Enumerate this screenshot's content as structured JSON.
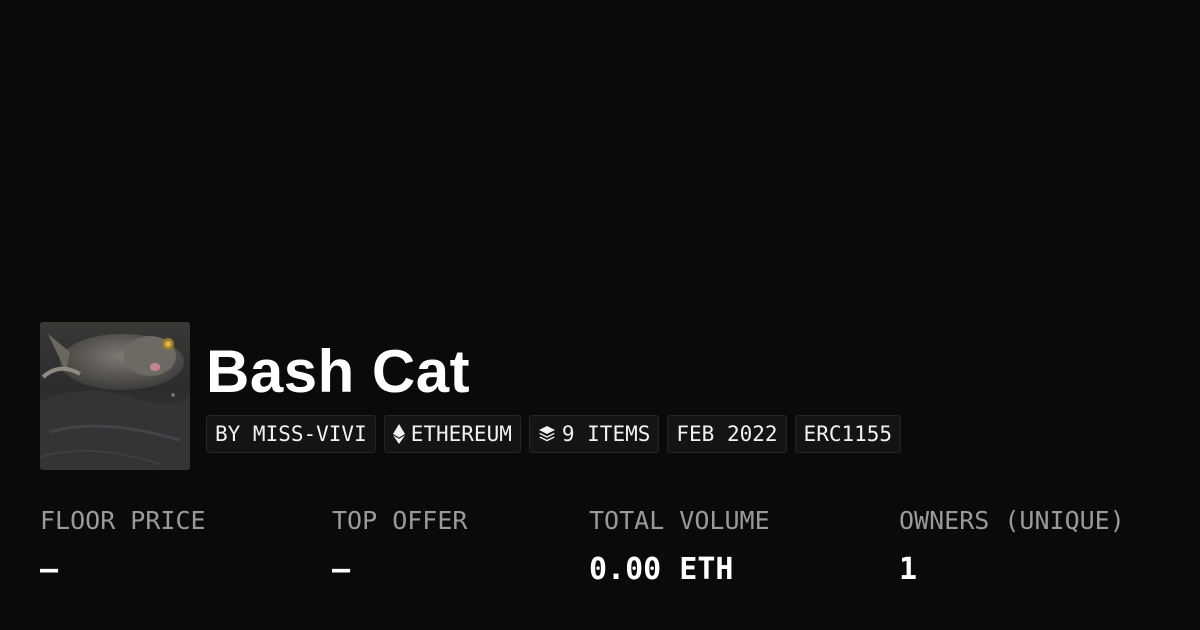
{
  "collection": {
    "name": "Bash Cat",
    "avatar_icon": "cat-photo"
  },
  "badges": {
    "creator": "BY MISS-VIVI",
    "chain": "ETHEREUM",
    "chain_icon": "ethereum-icon",
    "items": "9 ITEMS",
    "items_icon": "layers-icon",
    "date": "FEB 2022",
    "standard": "ERC1155"
  },
  "stats": {
    "floor_price": {
      "label": "FLOOR PRICE",
      "value": "–"
    },
    "top_offer": {
      "label": "TOP OFFER",
      "value": "–"
    },
    "total_volume": {
      "label": "TOTAL VOLUME",
      "value": "0.00 ETH"
    },
    "owners": {
      "label": "OWNERS (UNIQUE)",
      "value": "1"
    }
  },
  "colors": {
    "background": "#0a0a0a",
    "text": "#ffffff",
    "muted": "#9a9a9a",
    "badge_bg": "#141414"
  }
}
